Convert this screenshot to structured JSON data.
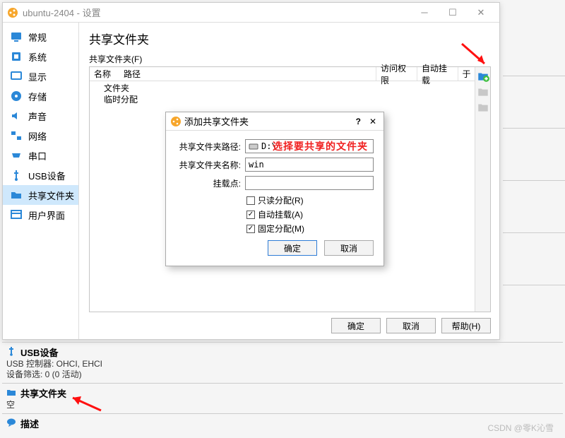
{
  "window": {
    "title": "ubuntu-2404 - 设置"
  },
  "sidebar": {
    "items": [
      {
        "label": "常规"
      },
      {
        "label": "系统"
      },
      {
        "label": "显示"
      },
      {
        "label": "存储"
      },
      {
        "label": "声音"
      },
      {
        "label": "网络"
      },
      {
        "label": "串口"
      },
      {
        "label": "USB设备"
      },
      {
        "label": "共享文件夹"
      },
      {
        "label": "用户界面"
      }
    ]
  },
  "page": {
    "title": "共享文件夹",
    "subhead": "共享文件夹(F)",
    "columns": {
      "name": "名称",
      "path": "路径",
      "access": "访问权限",
      "automount": "自动挂载",
      "at": "于"
    },
    "rows": [
      "文件夹",
      "临时分配"
    ]
  },
  "footer": {
    "ok": "确定",
    "cancel": "取消",
    "help": "帮助(H)"
  },
  "dialog": {
    "title": "添加共享文件夹",
    "labels": {
      "path": "共享文件夹路径:",
      "name": "共享文件夹名称:",
      "mount": "挂载点:"
    },
    "path_value": "D:\\",
    "name_value": "win",
    "overlay": "选择要共享的文件夹",
    "checks": {
      "readonly": "只读分配(R)",
      "automount": "自动挂载(A)",
      "permanent": "固定分配(M)"
    },
    "check_state": {
      "readonly": false,
      "automount": true,
      "permanent": true
    },
    "ok": "确定",
    "cancel": "取消"
  },
  "bg": {
    "usb_head": "USB设备",
    "usb_line1": "USB 控制器:  OHCI, EHCI",
    "usb_line2": "设备筛选:      0 (0 活动)",
    "share_head": "共享文件夹",
    "share_line": "空",
    "desc_head": "描述"
  },
  "watermark": "CSDN @零K沁雪"
}
